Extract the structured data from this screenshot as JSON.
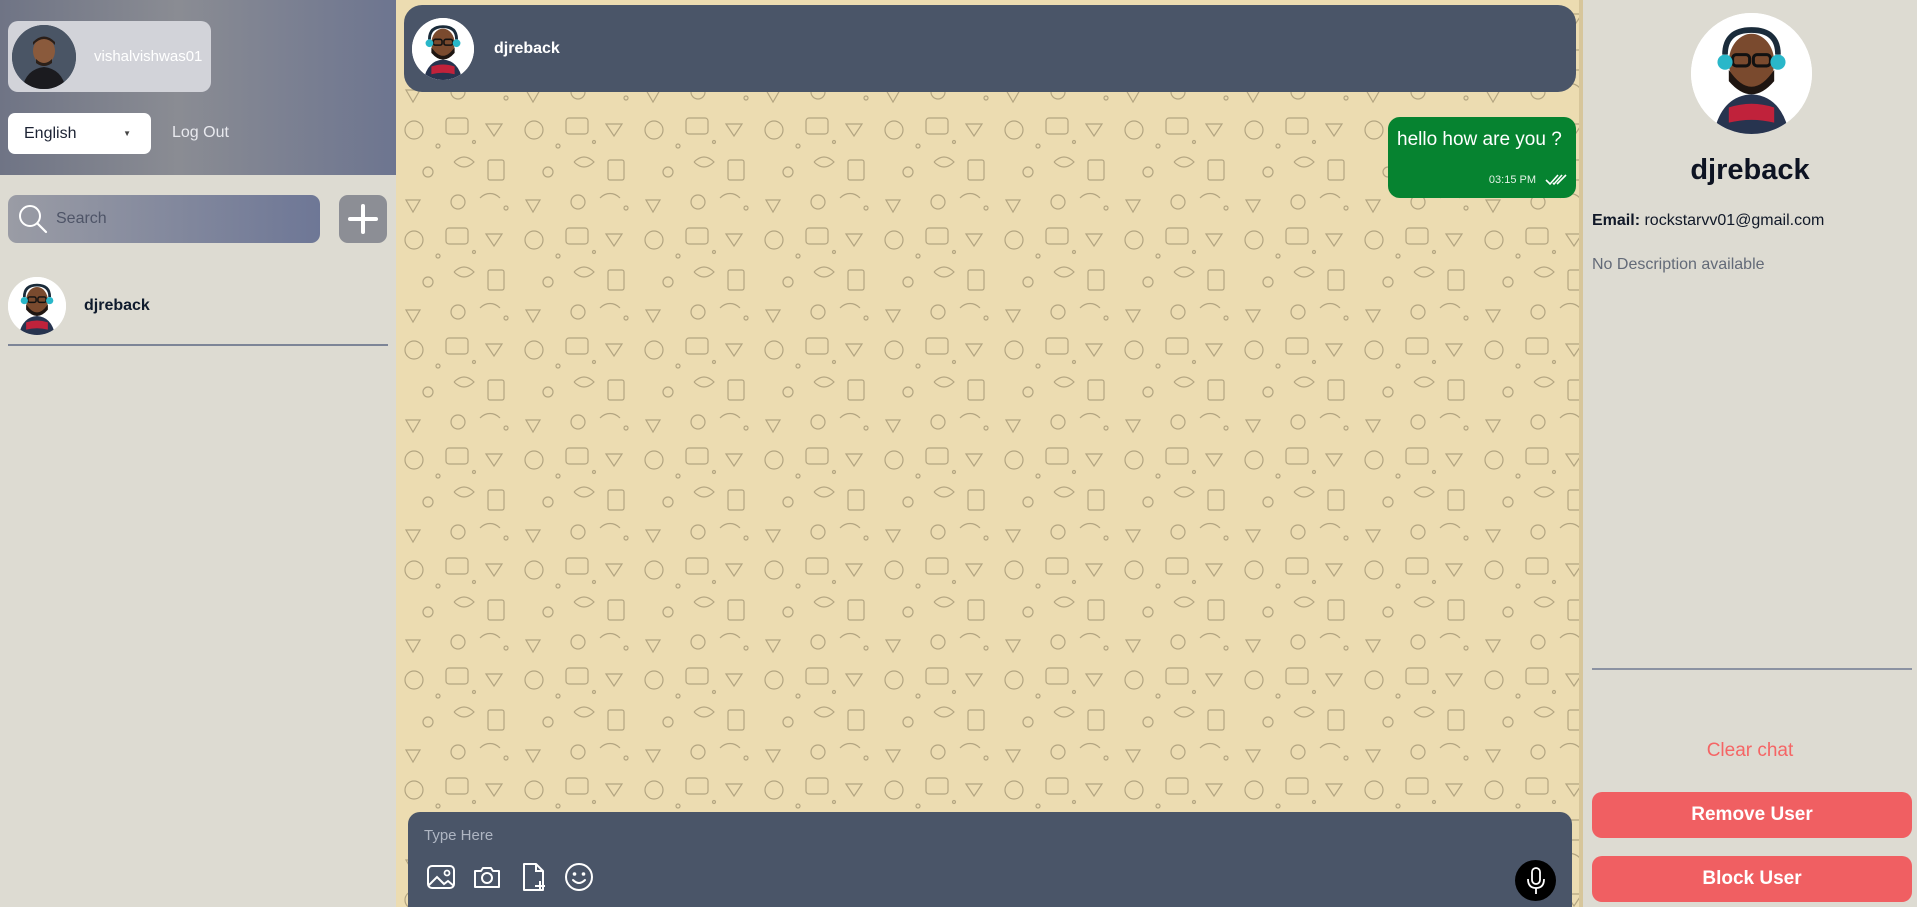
{
  "sidebar": {
    "profile": {
      "username": "vishalvishwas01"
    },
    "language": {
      "selected": "English"
    },
    "logout_label": "Log Out",
    "search": {
      "placeholder": "Search"
    },
    "contacts": [
      {
        "name": "djreback"
      }
    ]
  },
  "chat": {
    "header": {
      "name": "djreback"
    },
    "messages": [
      {
        "text": "hello how are you ?",
        "time": "03:15 PM",
        "status": "read",
        "direction": "outgoing"
      }
    ],
    "composer": {
      "placeholder": "Type Here"
    },
    "tools": [
      "gallery-icon",
      "camera-icon",
      "file-add-icon",
      "emoji-icon",
      "microphone-icon"
    ]
  },
  "panel": {
    "name": "djreback",
    "email_label": "Email:",
    "email": "rockstarvv01@gmail.com",
    "description": "No Description available",
    "clear_chat": "Clear chat",
    "remove_user": "Remove User",
    "block_user": "Block User"
  },
  "colors": {
    "bubble": "#068330",
    "header": "#4a5568",
    "danger": "#f05f62",
    "chat_bg": "#ecdcb1"
  }
}
